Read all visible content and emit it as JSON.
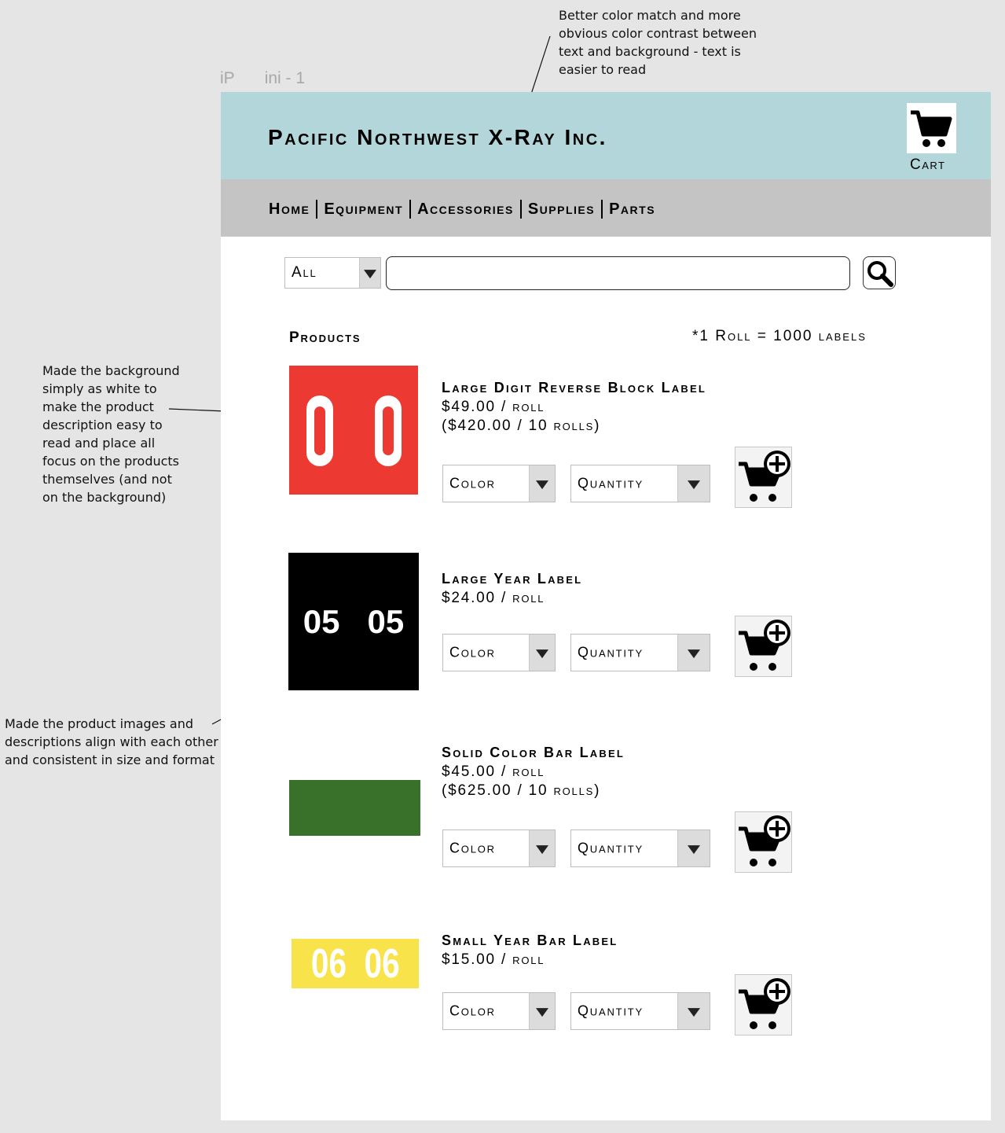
{
  "annotations": {
    "top": [
      "Better color match and more",
      "obvious color contrast between",
      "text and background - text is",
      "easier to read"
    ],
    "left1": [
      "Made the background",
      "simply as white to",
      "make the product",
      "description easy to",
      "read and place all",
      "focus on the products",
      "themselves (and not",
      "on the background)"
    ],
    "left2": [
      "Made the product images and",
      "descriptions align with each other",
      "and consistent in size and format"
    ]
  },
  "artboard": {
    "label_a": "iP",
    "label_b": "ini - 1"
  },
  "header": {
    "brand": "Pacific Northwest X-Ray Inc.",
    "cart_label": "Cart",
    "background": "#b3d6da"
  },
  "nav": {
    "items": [
      "Home",
      "Equipment",
      "Accessories",
      "Supplies",
      "Parts"
    ]
  },
  "search": {
    "category": "All",
    "placeholder": "",
    "value": ""
  },
  "products_section": {
    "title": "Products",
    "note": "*1 Roll = 1000 labels"
  },
  "products": [
    {
      "name": "Large Digit Reverse Block Label",
      "price": "$49.00 / roll",
      "bulk_price": "($420.00 / 10 rolls)",
      "color_label": "Color",
      "quantity_label": "Quantity",
      "image_text": "0  0",
      "image_color": "#ec3a32"
    },
    {
      "name": "Large Year Label",
      "price": "$24.00 / roll",
      "color_label": "Color",
      "quantity_label": "Quantity",
      "image_text": "05   05",
      "image_color": "#000000"
    },
    {
      "name": "Solid Color Bar Label",
      "price": "$45.00 / roll",
      "bulk_price": "($625.00 / 10 rolls)",
      "color_label": "Color",
      "quantity_label": "Quantity",
      "image_color": "#3a712a"
    },
    {
      "name": "Small Year Bar Label",
      "price": "$15.00 / roll",
      "color_label": "Color",
      "quantity_label": "Quantity",
      "image_text": "06  06",
      "image_color": "#f9e34a"
    }
  ],
  "icons": {
    "cart": "cart-icon",
    "add_to_cart": "add-to-cart-icon",
    "search": "magnifier-icon",
    "dropdown": "triangle-down-icon"
  }
}
